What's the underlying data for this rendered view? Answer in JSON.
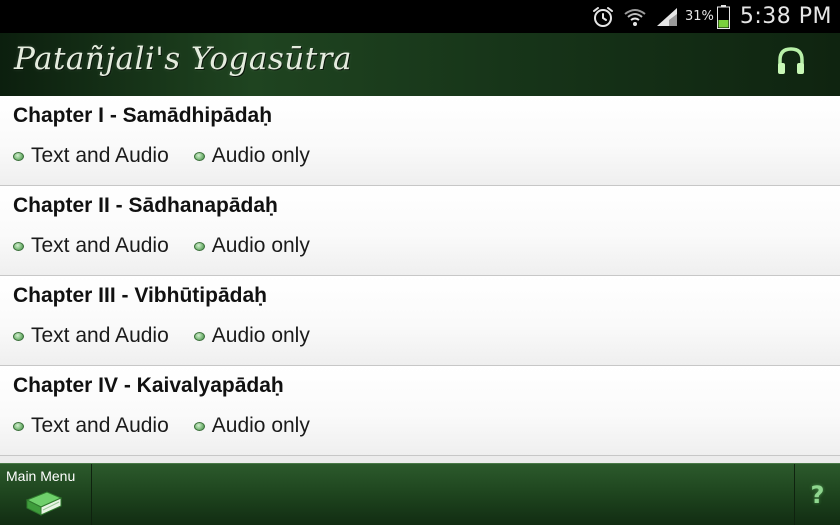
{
  "status_bar": {
    "battery_percent": "31%",
    "time": "5:38 PM",
    "icons": [
      "alarm-icon",
      "wifi-icon",
      "signal-icon",
      "battery-icon"
    ]
  },
  "app_header": {
    "title": "Patañjali's Yogasūtra",
    "action_icon": "headphones-icon"
  },
  "chapters": [
    {
      "title": "Chapter I - Samādhipādaḥ",
      "links": [
        "Text and Audio",
        "Audio only"
      ]
    },
    {
      "title": "Chapter II - Sādhanapādaḥ",
      "links": [
        "Text and Audio",
        "Audio only"
      ]
    },
    {
      "title": "Chapter III - Vibhūtipādaḥ",
      "links": [
        "Text and Audio",
        "Audio only"
      ]
    },
    {
      "title": "Chapter IV - Kaivalyapādaḥ",
      "links": [
        "Text and Audio",
        "Audio only"
      ]
    }
  ],
  "bottom_bar": {
    "main_menu_label": "Main Menu",
    "main_menu_icon": "book-icon",
    "help_label": "?"
  },
  "colors": {
    "header_green": "#1f4420",
    "bottom_green": "#1f461f",
    "bullet_green": "#8cc48a",
    "help_green": "#8fd68f",
    "battery_green": "#7ad03c"
  }
}
